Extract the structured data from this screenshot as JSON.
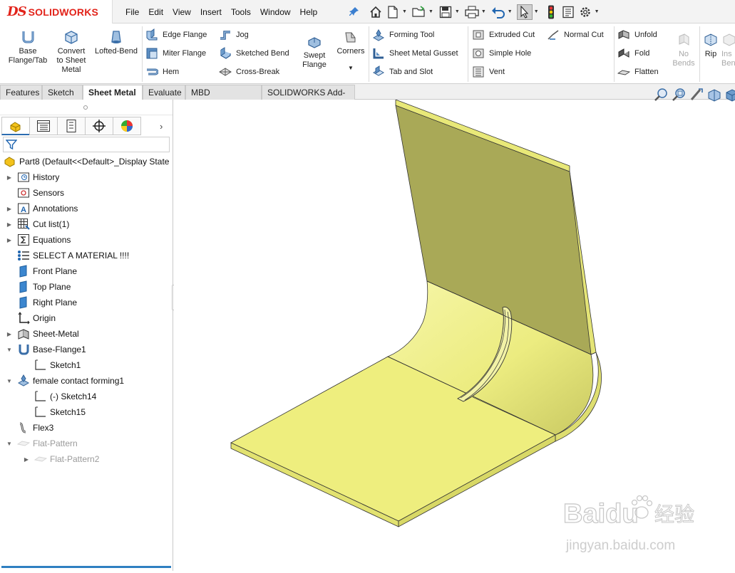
{
  "app": {
    "logo_ds": "DS",
    "logo_name": "SOLIDWORKS"
  },
  "menu": [
    "File",
    "Edit",
    "View",
    "Insert",
    "Tools",
    "Window",
    "Help"
  ],
  "quick_access_icons": [
    "home-icon",
    "new-document-icon",
    "open-icon",
    "save-icon",
    "print-icon",
    "undo-icon",
    "select-icon",
    "rebuild-icon",
    "file-properties-icon",
    "options-icon"
  ],
  "command_manager": {
    "base_flange": "Base\nFlange/Tab",
    "convert_sheet": "Convert\nto Sheet\nMetal",
    "lofted_bend": "Lofted-Bend",
    "edge_flange": "Edge Flange",
    "miter_flange": "Miter Flange",
    "hem": "Hem",
    "jog": "Jog",
    "sketched_bend": "Sketched Bend",
    "cross_break": "Cross-Break",
    "swept_flange": "Swept\nFlange",
    "corners": "Corners",
    "forming_tool": "Forming Tool",
    "sheet_metal_gusset": "Sheet Metal Gusset",
    "tab_and_slot": "Tab and Slot",
    "extruded_cut": "Extruded Cut",
    "simple_hole": "Simple Hole",
    "vent": "Vent",
    "normal_cut": "Normal Cut",
    "unfold": "Unfold",
    "fold": "Fold",
    "flatten": "Flatten",
    "no_bends": "No\nBends",
    "rip": "Rip",
    "insert_bends": "Ins\nBen"
  },
  "tabs": [
    "Features",
    "Sketch",
    "Sheet Metal",
    "Evaluate",
    "MBD Dimensions",
    "SOLIDWORKS Add-Ins"
  ],
  "active_tab": "Sheet Metal",
  "feature_tree": {
    "root": "Part8  (Default<<Default>_Display State",
    "items": [
      {
        "label": "History",
        "icon": "history-folder-icon",
        "expand": true,
        "indent": 0
      },
      {
        "label": "Sensors",
        "icon": "sensors-icon",
        "expand": false,
        "indent": 0
      },
      {
        "label": "Annotations",
        "icon": "annotations-icon",
        "expand": true,
        "indent": 0
      },
      {
        "label": "Cut list(1)",
        "icon": "cut-list-icon",
        "expand": true,
        "indent": 0
      },
      {
        "label": "Equations",
        "icon": "equations-icon",
        "expand": true,
        "indent": 0
      },
      {
        "label": "SELECT A MATERIAL !!!!",
        "icon": "material-icon",
        "expand": false,
        "indent": 0
      },
      {
        "label": "Front Plane",
        "icon": "plane-icon",
        "expand": false,
        "indent": 0
      },
      {
        "label": "Top Plane",
        "icon": "plane-icon",
        "expand": false,
        "indent": 0
      },
      {
        "label": "Right Plane",
        "icon": "plane-icon",
        "expand": false,
        "indent": 0
      },
      {
        "label": "Origin",
        "icon": "origin-icon",
        "expand": false,
        "indent": 0
      },
      {
        "label": "Sheet-Metal",
        "icon": "sheet-metal-icon",
        "expand": true,
        "indent": 0
      },
      {
        "label": "Base-Flange1",
        "icon": "base-flange-icon",
        "expand": "open",
        "indent": 0
      },
      {
        "label": "Sketch1",
        "icon": "sketch-icon",
        "expand": false,
        "indent": 1
      },
      {
        "label": "female contact forming1",
        "icon": "forming-tool-icon",
        "expand": "open",
        "indent": 0
      },
      {
        "label": "(-) Sketch14",
        "icon": "sketch-icon",
        "expand": false,
        "indent": 1
      },
      {
        "label": "Sketch15",
        "icon": "sketch-icon",
        "expand": false,
        "indent": 1
      },
      {
        "label": "Flex3",
        "icon": "flex-icon",
        "expand": false,
        "indent": 0
      },
      {
        "label": "Flat-Pattern",
        "icon": "flat-pattern-icon",
        "expand": "open",
        "indent": 0,
        "suppressed": true
      },
      {
        "label": "Flat-Pattern2",
        "icon": "flat-pattern-icon",
        "expand": true,
        "indent": 1,
        "suppressed": true
      }
    ]
  },
  "viewport_icons": [
    "zoom-to-fit-icon",
    "zoom-area-icon",
    "previous-view-icon",
    "section-view-icon",
    "view-orientation-icon"
  ],
  "watermark": {
    "brand": "Baidu",
    "brand_cn": "经验",
    "url": "jingyan.baidu.com"
  },
  "colors": {
    "part_face": "#ecec7c",
    "part_top": "#a8a84e",
    "accent": "#2f7fc1",
    "logo_red": "#e2231a"
  }
}
